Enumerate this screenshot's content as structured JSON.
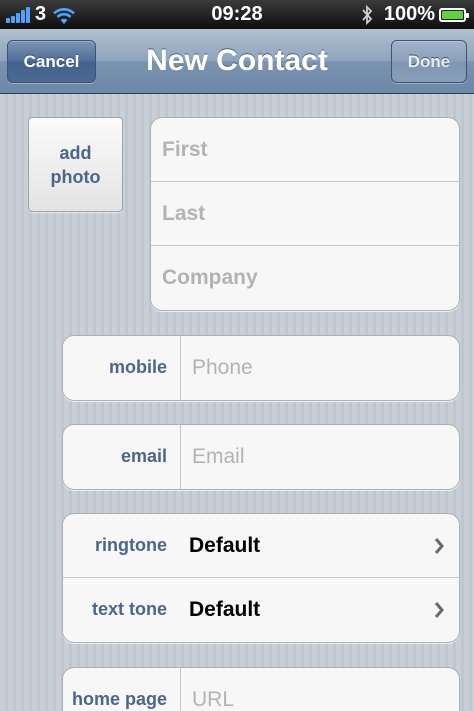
{
  "status_bar": {
    "carrier": "3",
    "time": "09:28",
    "battery_percent": "100%",
    "battery_level": 1.0,
    "icons": [
      "signal-icon",
      "wifi-icon",
      "bluetooth-icon",
      "battery-icon"
    ]
  },
  "nav": {
    "title": "New Contact",
    "cancel_label": "Cancel",
    "done_label": "Done"
  },
  "photo": {
    "line1": "add",
    "line2": "photo"
  },
  "name_fields": {
    "first_placeholder": "First",
    "last_placeholder": "Last",
    "company_placeholder": "Company"
  },
  "phone": {
    "label": "mobile",
    "placeholder": "Phone"
  },
  "email": {
    "label": "email",
    "placeholder": "Email"
  },
  "tones": {
    "ringtone_label": "ringtone",
    "ringtone_value": "Default",
    "text_tone_label": "text tone",
    "text_tone_value": "Default"
  },
  "url": {
    "label": "home page",
    "placeholder": "URL"
  },
  "colors": {
    "label_blue": "#4c6689",
    "placeholder_gray": "#b3b3b3",
    "battery_green": "#5fd33c",
    "signal_blue": "#4ca4ff"
  }
}
